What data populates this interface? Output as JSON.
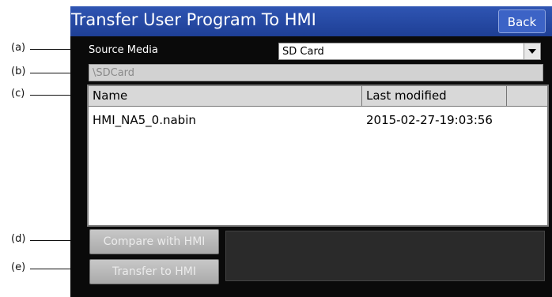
{
  "callouts": [
    "(a)",
    "(b)",
    "(c)",
    "(d)",
    "(e)"
  ],
  "window": {
    "title": "Transfer User Program To HMI",
    "back_label": "Back"
  },
  "source": {
    "label": "Source Media",
    "selected": "SD Card"
  },
  "path": "\\SDCard",
  "table": {
    "columns": [
      "Name",
      "Last modified",
      ""
    ],
    "rows": [
      {
        "name": "HMI_NA5_0.nabin",
        "modified": "2015-02-27-19:03:56"
      }
    ]
  },
  "buttons": {
    "compare": "Compare with HMI",
    "transfer": "Transfer to HMI"
  },
  "colors": {
    "title_bar": "#2447a6",
    "screen_bg": "#0a0a0a",
    "button_disabled": "#b8b8b8"
  }
}
